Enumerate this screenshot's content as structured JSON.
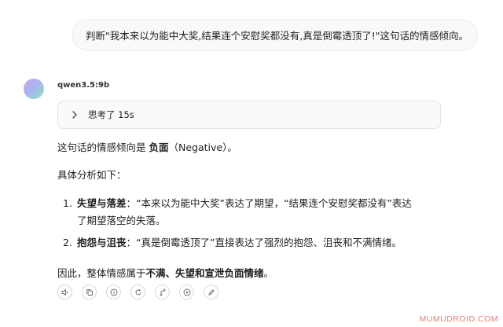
{
  "user_message": "判断\"我本来以为能中大奖,结果连个安慰奖都没有,真是倒霉透顶了!\"这句话的情感倾向。",
  "assistant": {
    "name": "qwen3.5:9b",
    "thinking_label": "思考了 15s",
    "intro_prefix": "这句话的情感倾向是 ",
    "intro_bold": "负面",
    "intro_suffix": "（Negative）。",
    "analysis_heading": "具体分析如下：",
    "items": [
      {
        "num": "1.",
        "title": "失望与落差",
        "text": "：“本来以为能中大奖”表达了期望，“结果连个安慰奖都没有”表达了期望落空的失落。"
      },
      {
        "num": "2.",
        "title": "抱怨与沮丧",
        "text": "：“真是倒霉透顶了”直接表达了强烈的抱怨、沮丧和不满情绪。"
      }
    ],
    "conclusion_prefix": "因此，整体情感属于",
    "conclusion_bold": "不满、失望和宣泄负面情绪",
    "conclusion_suffix": "。"
  },
  "actions": [
    "speaker-icon",
    "copy-icon",
    "info-icon",
    "regenerate-icon",
    "branch-icon",
    "play-icon",
    "edit-icon"
  ],
  "watermark": "MUMUDROID.COM"
}
